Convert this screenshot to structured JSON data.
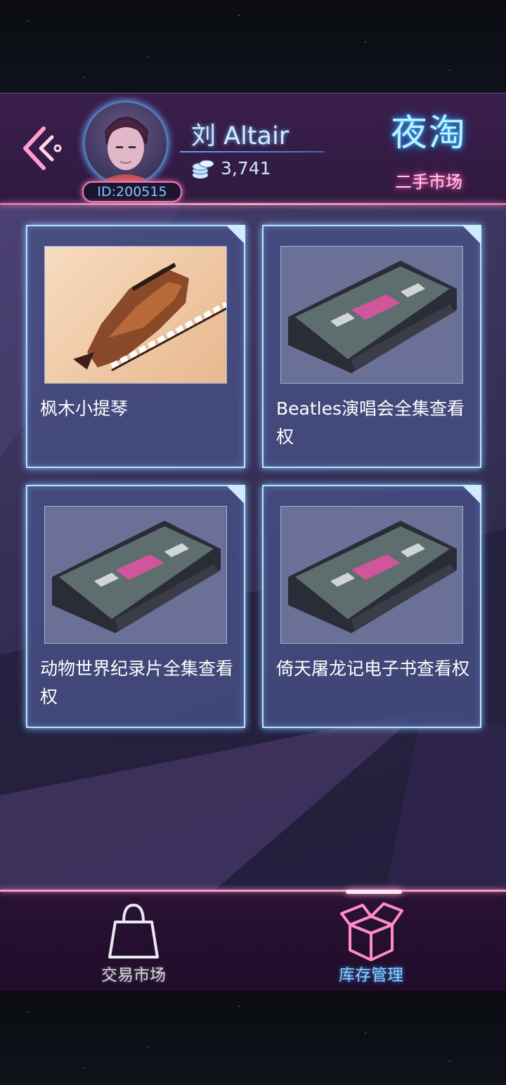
{
  "player": {
    "name": "刘 Altair",
    "coins": "3,741",
    "id": "ID:200515"
  },
  "logo": {
    "title": "夜淘",
    "subtitle": "二手市场"
  },
  "inventory": [
    {
      "label": "枫木小提琴",
      "icon": "violin-pixel-icon"
    },
    {
      "label": "Beatles演唱会全集查看权",
      "icon": "cassette-tape-icon"
    },
    {
      "label": "动物世界纪录片全集查看权",
      "icon": "cassette-tape-icon"
    },
    {
      "label": "倚天屠龙记电子书查看权",
      "icon": "cassette-tape-icon"
    }
  ],
  "nav": {
    "market": "交易市场",
    "stock": "库存管理",
    "active": "stock"
  },
  "colors": {
    "neon_pink": "#f07ab4",
    "neon_blue": "#7cc6ff",
    "card_bg": "#464e82"
  }
}
